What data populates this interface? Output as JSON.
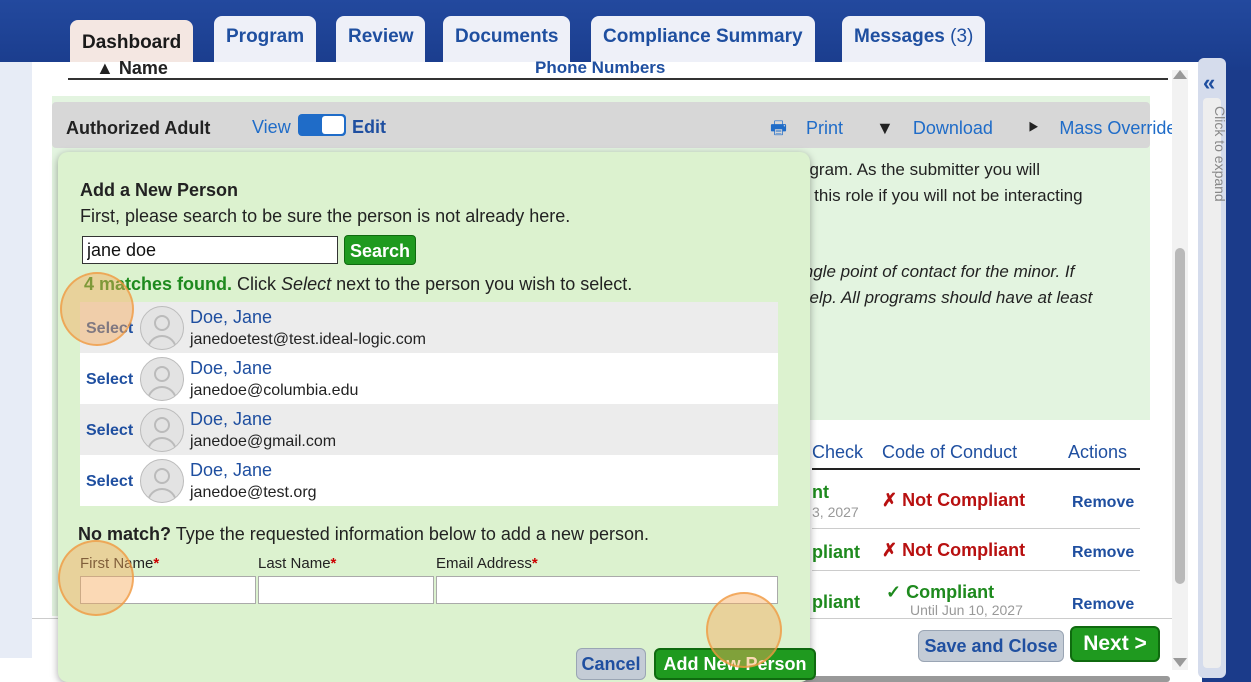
{
  "tabs": [
    {
      "label": "Dashboard"
    },
    {
      "label": "Program"
    },
    {
      "label": "Review"
    },
    {
      "label": "Documents"
    },
    {
      "label": "Compliance Summary"
    },
    {
      "label": "Messages",
      "count": "(3)"
    }
  ],
  "background": {
    "col_name": "Name",
    "col_phone": "Phone Numbers",
    "section_title": "Authorized Adult",
    "view_label": "View",
    "edit_label": "Edit",
    "print_label": "Print",
    "download_label": "Download",
    "mass_override_label": "Mass Override",
    "text_lines": [
      "ogram. As the submitter you will",
      "n this role if you will not be interacting"
    ],
    "italic_lines": [
      "ingle point of contact for the minor. If",
      "help. All programs should have at least"
    ],
    "table_headers": {
      "check": "Check",
      "code": "Code of Conduct",
      "actions": "Actions"
    },
    "rows": [
      {
        "check": "nt",
        "check_sub": "3, 2027",
        "code": "Not Compliant",
        "action": "Remove"
      },
      {
        "check": "pliant",
        "code": "Not Compliant",
        "action": "Remove"
      },
      {
        "check": "pliant",
        "code": "Compliant",
        "code_sub": "Until Jun 10, 2027",
        "action": "Remove"
      }
    ],
    "expand_label": "Click to expand",
    "save_close_label": "Save and Close",
    "next_label": "Next >"
  },
  "popup": {
    "title": "Add a New Person",
    "instruction": "First, please search to be sure the person is not already here.",
    "search_value": "jane doe",
    "search_button": "Search",
    "matches_count": "4 matches found.",
    "matches_text_a": "Click ",
    "matches_text_em": "Select",
    "matches_text_b": " next to the person you wish to select.",
    "results": [
      {
        "select": "Select",
        "name": "Doe, Jane",
        "email": "janedoetest@test.ideal-logic.com"
      },
      {
        "select": "Select",
        "name": "Doe, Jane",
        "email": "janedoe@columbia.edu"
      },
      {
        "select": "Select",
        "name": "Doe, Jane",
        "email": "janedoe@gmail.com"
      },
      {
        "select": "Select",
        "name": "Doe, Jane",
        "email": "janedoe@test.org"
      }
    ],
    "no_match_bold": "No match?",
    "no_match_text": " Type the requested information below to add a new person.",
    "first_name_label": "First Name",
    "last_name_label": "Last Name",
    "email_label": "Email Address",
    "required_mark": "*",
    "cancel_label": "Cancel",
    "add_label": "Add New Person"
  },
  "colors": {
    "accent": "#1f4fa0",
    "green": "#1f9a1f",
    "red": "#b81010",
    "popup_bg": "#dcf2cf"
  }
}
